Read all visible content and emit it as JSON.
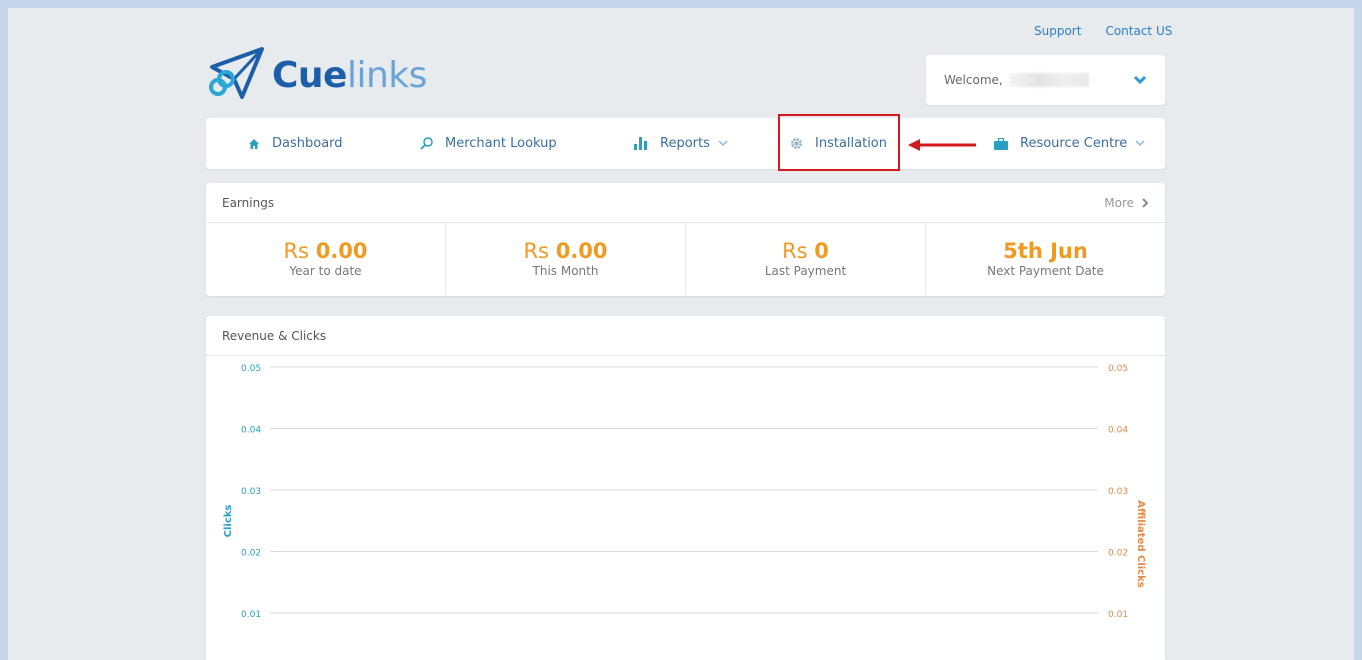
{
  "toplinks": {
    "support": "Support",
    "contact": "Contact US"
  },
  "logo": {
    "bold": "Cue",
    "light": "links"
  },
  "welcome": {
    "label": "Welcome,"
  },
  "nav": {
    "items": [
      {
        "label": "Dashboard",
        "icon": "home-icon"
      },
      {
        "label": "Merchant Lookup",
        "icon": "search-icon"
      },
      {
        "label": "Reports",
        "icon": "bar-chart-icon",
        "dropdown": true
      },
      {
        "label": "Installation",
        "icon": "gear-icon",
        "highlighted": true
      },
      {
        "label": "Resource Centre",
        "icon": "briefcase-icon",
        "dropdown": true
      }
    ]
  },
  "earnings": {
    "title": "Earnings",
    "more": "More",
    "stats": [
      {
        "currency": "Rs",
        "value": "0.00",
        "label": "Year to date"
      },
      {
        "currency": "Rs",
        "value": "0.00",
        "label": "This Month"
      },
      {
        "currency": "Rs",
        "value": "0",
        "label": "Last Payment"
      },
      {
        "currency": "",
        "value": "5th Jun",
        "label": "Next Payment Date"
      }
    ]
  },
  "revenue": {
    "title": "Revenue & Clicks"
  },
  "colors": {
    "left_axis": "#2a9fc0",
    "right_axis": "#e08a4a",
    "accent": "#ef9a22",
    "highlight": "#d4191c"
  },
  "chart_data": {
    "type": "line",
    "y_left": {
      "label": "Clicks",
      "ticks": [
        "0.05",
        "0.04",
        "0.03",
        "0.02",
        "0.01"
      ]
    },
    "y_right": {
      "label": "Affiliated Clicks",
      "ticks": [
        "0.05",
        "0.04",
        "0.03",
        "0.02",
        "0.01"
      ]
    },
    "ylim": [
      0,
      0.05
    ],
    "grid": true,
    "series": []
  }
}
